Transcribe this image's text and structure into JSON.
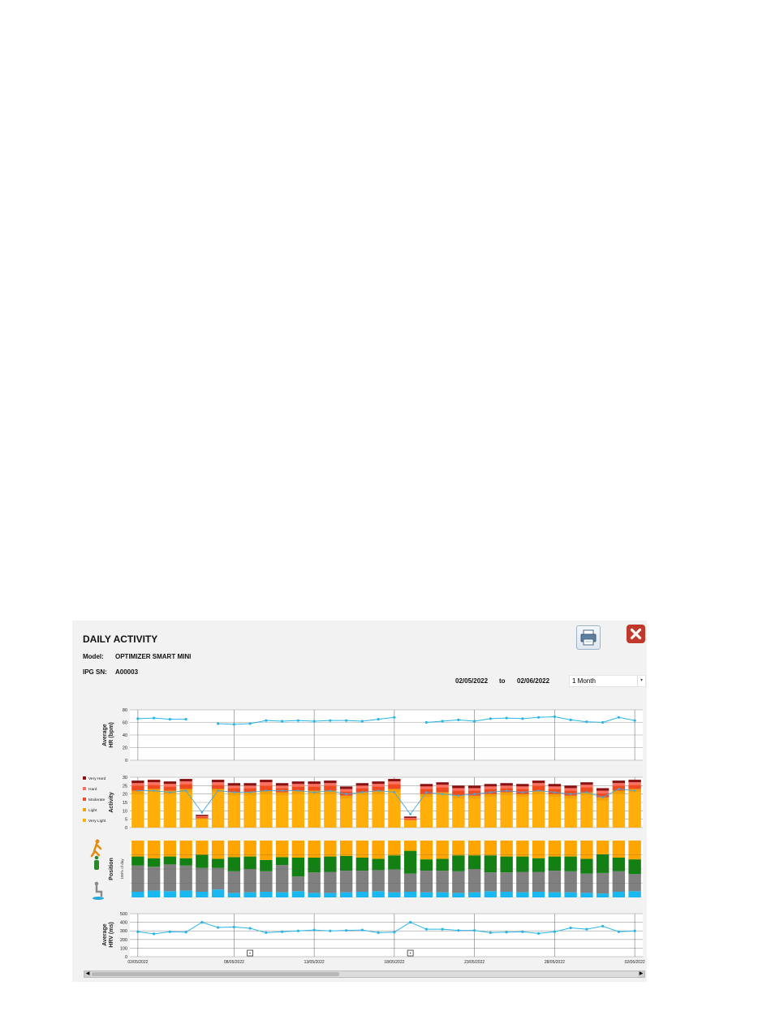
{
  "header": {
    "title": "DAILY ACTIVITY",
    "model_label": "Model:",
    "model_value": "OPTIMIZER SMART MINI",
    "sn_label": "IPG SN:",
    "sn_value": "A00003",
    "date_from": "02/05/2022",
    "to_label": "to",
    "date_to": "02/06/2022",
    "range_selected": "1 Month"
  },
  "icons": {
    "print": "printer-icon",
    "close": "close-icon",
    "position": "posture-figures-icon",
    "marker": "event-marker-icon"
  },
  "colors": {
    "hr_line": "#29b6e6",
    "very_hard": "#8b1010",
    "hard": "#ff7060",
    "moderate": "#ef4a20",
    "light": "#f3a100",
    "very_light": "#ffae0a",
    "position_upright": "#ffa500",
    "position_active": "#128012",
    "position_sitting": "#808080",
    "position_lying": "#1ab8f0",
    "close_button": "#c0392b"
  },
  "chart_data": [
    {
      "type": "line",
      "title": "",
      "ylabel": "Average HR (bpm)",
      "ylim": [
        0,
        80
      ],
      "yticks": [
        0,
        20,
        40,
        60,
        80
      ],
      "x": [
        "02/05/2022",
        "03/05/2022",
        "04/05/2022",
        "05/05/2022",
        "06/05/2022",
        "07/05/2022",
        "08/05/2022",
        "09/05/2022",
        "10/05/2022",
        "11/05/2022",
        "12/05/2022",
        "13/05/2022",
        "14/05/2022",
        "15/05/2022",
        "16/05/2022",
        "17/05/2022",
        "18/05/2022",
        "19/05/2022",
        "20/05/2022",
        "21/05/2022",
        "22/05/2022",
        "23/05/2022",
        "24/05/2022",
        "25/05/2022",
        "26/05/2022",
        "27/05/2022",
        "28/05/2022",
        "29/05/2022",
        "30/05/2022",
        "31/05/2022",
        "01/06/2022",
        "02/06/2022"
      ],
      "values": [
        66,
        67,
        65,
        65,
        null,
        58,
        57,
        58,
        63,
        62,
        63,
        62,
        63,
        63,
        62,
        65,
        68,
        null,
        60,
        62,
        64,
        62,
        66,
        67,
        66,
        68,
        69,
        64,
        61,
        60,
        68,
        63
      ],
      "xtick_labels": [
        "02/05/2022",
        "08/05/2022",
        "13/05/2022",
        "18/05/2022",
        "23/05/2022",
        "28/05/2022",
        "02/06/2022"
      ],
      "grid": true
    },
    {
      "type": "bar",
      "stacked": true,
      "ylabel": "Activity",
      "ylim": [
        0,
        30
      ],
      "yticks": [
        0,
        5,
        10,
        15,
        20,
        25,
        30
      ],
      "legend_position": "left",
      "legend": [
        "Very Hard",
        "Hard",
        "Moderate",
        "Light",
        "Very Light"
      ],
      "series": [
        {
          "name": "Very Light",
          "values": [
            20,
            21,
            20,
            21,
            5,
            21,
            19,
            19,
            20,
            19,
            20,
            20,
            20,
            17,
            19,
            20,
            21,
            4,
            18,
            19,
            17,
            17,
            18,
            19,
            18,
            20,
            18,
            17,
            19,
            16,
            20,
            21
          ]
        },
        {
          "name": "Light",
          "values": [
            2,
            2,
            2,
            2,
            0.5,
            2,
            2,
            2,
            2,
            2,
            2,
            2,
            2,
            2,
            2,
            2,
            2,
            0.5,
            2,
            2,
            2,
            2,
            2,
            2,
            2,
            2,
            2,
            2,
            2,
            2,
            2,
            2
          ]
        },
        {
          "name": "Moderate",
          "values": [
            3,
            2.5,
            2.5,
            3,
            0.8,
            2.5,
            2.5,
            2.5,
            3,
            2.5,
            2.5,
            2.5,
            3,
            2.5,
            2.5,
            2.5,
            3,
            0.8,
            3,
            3,
            3,
            3,
            3,
            2.5,
            3,
            3,
            3,
            3,
            3,
            2.5,
            3,
            2.5
          ]
        },
        {
          "name": "Hard",
          "values": [
            1.5,
            1.5,
            1.5,
            1.5,
            0.5,
            1.5,
            1.5,
            1.5,
            2,
            1.5,
            1.5,
            1.5,
            1.5,
            1.5,
            1.5,
            1.5,
            1.5,
            0.5,
            1.5,
            1.5,
            1.5,
            1.5,
            1.5,
            1.5,
            1.5,
            1.5,
            1.5,
            1.5,
            1.5,
            1.5,
            1.5,
            1.5
          ]
        },
        {
          "name": "Very Hard",
          "values": [
            1.5,
            1.5,
            1.5,
            1.5,
            0.8,
            1.5,
            1.5,
            1.5,
            1.5,
            1.5,
            1.5,
            1.5,
            1.5,
            1.5,
            1.5,
            1.5,
            1.5,
            0.8,
            1.5,
            1.5,
            1.5,
            1.5,
            1.5,
            1.5,
            1.5,
            1.5,
            1.5,
            1.5,
            1.5,
            1.5,
            1.5,
            1.5
          ]
        }
      ],
      "overlay_line": [
        22,
        22,
        21,
        22,
        9,
        22,
        21,
        21,
        22,
        22,
        22,
        21,
        22,
        20,
        21,
        22,
        21,
        8,
        21,
        20,
        19,
        20,
        21,
        22,
        21,
        22,
        21,
        20,
        21,
        18,
        23,
        22
      ],
      "grid": true
    },
    {
      "type": "bar",
      "stacked": true,
      "ylabel": "Position",
      "axis_note": "100% of day",
      "ylim": [
        0,
        100
      ],
      "series": [
        {
          "name": "Lying",
          "values": [
            10,
            12,
            11,
            12,
            10,
            14,
            8,
            9,
            10,
            9,
            11,
            8,
            8,
            9,
            10,
            11,
            9,
            10,
            9,
            9,
            8,
            9,
            11,
            10,
            9,
            10,
            9,
            9,
            8,
            7,
            10,
            11
          ]
        },
        {
          "name": "Sitting",
          "values": [
            46,
            42,
            47,
            44,
            42,
            38,
            38,
            41,
            36,
            48,
            26,
            36,
            37,
            38,
            37,
            37,
            40,
            32,
            38,
            38,
            38,
            41,
            33,
            34,
            36,
            35,
            38,
            37,
            34,
            36,
            36,
            30
          ]
        },
        {
          "name": "Active",
          "values": [
            16,
            15,
            14,
            13,
            23,
            16,
            25,
            22,
            20,
            14,
            33,
            26,
            27,
            26,
            23,
            20,
            25,
            40,
            20,
            21,
            28,
            24,
            30,
            28,
            27,
            24,
            25,
            26,
            26,
            33,
            24,
            26
          ]
        },
        {
          "name": "Upright",
          "values": [
            28,
            31,
            28,
            31,
            25,
            32,
            29,
            28,
            34,
            29,
            30,
            30,
            28,
            27,
            30,
            32,
            26,
            18,
            33,
            32,
            26,
            26,
            26,
            28,
            28,
            31,
            28,
            28,
            32,
            24,
            30,
            33
          ]
        }
      ],
      "grid": true
    },
    {
      "type": "line",
      "ylabel": "Average HRV (ms)",
      "ylim": [
        0,
        500
      ],
      "yticks": [
        0,
        100,
        200,
        300,
        400,
        500
      ],
      "values": [
        290,
        265,
        290,
        285,
        400,
        340,
        345,
        330,
        280,
        290,
        300,
        310,
        300,
        305,
        310,
        280,
        285,
        400,
        320,
        320,
        305,
        305,
        280,
        285,
        290,
        270,
        290,
        335,
        320,
        355,
        290,
        300
      ],
      "event_markers": [
        7,
        17
      ],
      "grid": true
    }
  ]
}
